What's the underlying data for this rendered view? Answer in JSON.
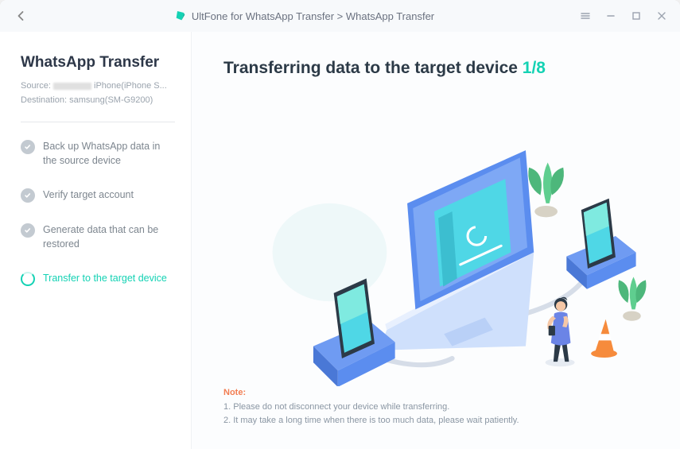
{
  "titlebar": {
    "breadcrumb_app": "UltFone for WhatsApp Transfer",
    "breadcrumb_sep": " > ",
    "breadcrumb_page": "WhatsApp Transfer"
  },
  "sidebar": {
    "title": "WhatsApp Transfer",
    "source_label": "Source: ",
    "source_device": " iPhone(iPhone S...",
    "dest_label": "Destination: ",
    "dest_device": "samsung(SM-G9200)",
    "steps": [
      {
        "label": "Back up WhatsApp data in the source device",
        "state": "done"
      },
      {
        "label": "Verify target account",
        "state": "done"
      },
      {
        "label": "Generate data that can be restored",
        "state": "done"
      },
      {
        "label": "Transfer to the target device",
        "state": "active"
      }
    ]
  },
  "main": {
    "heading": "Transferring data to the target device",
    "progress_counter": "1/8",
    "note_label": "Note:",
    "note_line1": "1. Please do not disconnect your device while transferring.",
    "note_line2": "2. It may take a long time when there is too much data, please wait patiently."
  },
  "colors": {
    "accent": "#14d2b4",
    "bluebase": "#5b8def"
  }
}
